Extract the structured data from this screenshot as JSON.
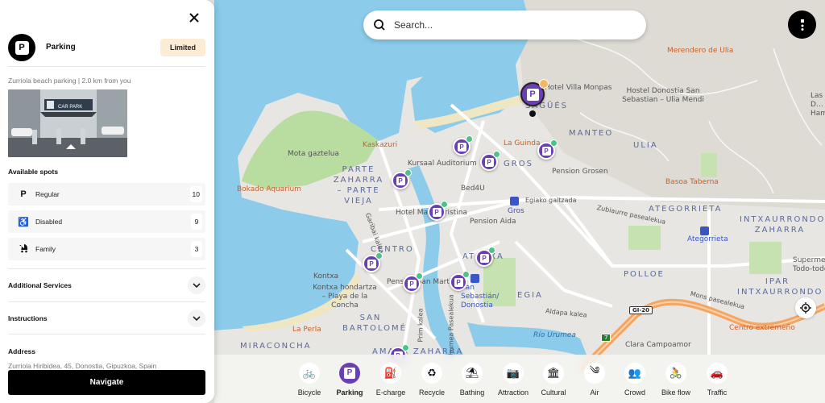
{
  "panel": {
    "title": "Parking",
    "status": "Limited",
    "subtitle": "Zurriola beach parking | 2.0 km from you",
    "photo_sign": "CAR PARK",
    "spots_heading": "Available spots",
    "spots": [
      {
        "icon": "parking-icon",
        "label": "Regular",
        "count": "10"
      },
      {
        "icon": "wheelchair-icon",
        "label": "Disabled",
        "count": "9"
      },
      {
        "icon": "stroller-icon",
        "label": "Family",
        "count": "3"
      }
    ],
    "sections": [
      {
        "label": "Additional Services"
      },
      {
        "label": "Instructions"
      }
    ],
    "address_heading": "Address",
    "address": "Zurriola Hiribidea, 45, Donostia, Gipuzkoa, Spain",
    "navigate_label": "Navigate"
  },
  "search": {
    "placeholder": "Search..."
  },
  "categories": [
    {
      "label": "Bicycle",
      "icon": "bicycle-icon",
      "glyph": "🚲",
      "active": false
    },
    {
      "label": "Parking",
      "icon": "parking-icon",
      "glyph": "P",
      "active": true
    },
    {
      "label": "E-charge",
      "icon": "ev-charger-icon",
      "glyph": "⛽",
      "active": false
    },
    {
      "label": "Recycle",
      "icon": "recycle-icon",
      "glyph": "♻",
      "active": false
    },
    {
      "label": "Bathing",
      "icon": "beach-icon",
      "glyph": "⛱",
      "active": false
    },
    {
      "label": "Attraction",
      "icon": "camera-icon",
      "glyph": "📷",
      "active": false
    },
    {
      "label": "Cultural",
      "icon": "museum-icon",
      "glyph": "🏛",
      "active": false
    },
    {
      "label": "Air",
      "icon": "wind-icon",
      "glyph": "༄",
      "active": false
    },
    {
      "label": "Crowd",
      "icon": "crowd-icon",
      "glyph": "👥",
      "active": false
    },
    {
      "label": "Bike flow",
      "icon": "cyclist-icon",
      "glyph": "🚴",
      "active": false
    },
    {
      "label": "Traffic",
      "icon": "car-icon",
      "glyph": "🚗",
      "active": false
    }
  ],
  "map": {
    "labels": [
      {
        "text": "Merendero de Ulia",
        "kind": "poi-food"
      },
      {
        "text": "Hotel Villa Monpas",
        "kind": "poi"
      },
      {
        "text": "Hostel Donostia San Sebastian – Ulia Mendi",
        "kind": "poi"
      },
      {
        "text": "Las D… Ham…",
        "kind": "poi"
      },
      {
        "text": "SAGÜÉS",
        "kind": "district"
      },
      {
        "text": "MANTEO",
        "kind": "district"
      },
      {
        "text": "ULIA",
        "kind": "district"
      },
      {
        "text": "La Guinda",
        "kind": "poi-food"
      },
      {
        "text": "GROS",
        "kind": "district"
      },
      {
        "text": "Pension Grosen",
        "kind": "poi"
      },
      {
        "text": "Basoa Taberna",
        "kind": "poi-food"
      },
      {
        "text": "Mota gaztelua",
        "kind": "poi"
      },
      {
        "text": "Kaskazuri",
        "kind": "poi-food"
      },
      {
        "text": "Kursaal Auditorium",
        "kind": "poi"
      },
      {
        "text": "PARTE ZAHARRA – PARTE VIEJA",
        "kind": "district"
      },
      {
        "text": "Bokado Aquarium",
        "kind": "poi-food"
      },
      {
        "text": "Bed4U",
        "kind": "poi"
      },
      {
        "text": "Egiako galtzada",
        "kind": "street"
      },
      {
        "text": "Gros",
        "kind": "transit"
      },
      {
        "text": "Zubiaurre pasealekua",
        "kind": "street"
      },
      {
        "text": "ATEGORRIETA",
        "kind": "district"
      },
      {
        "text": "INTXAURRONDO ZAHARRA",
        "kind": "district"
      },
      {
        "text": "Hotel Maria Cristina",
        "kind": "poi"
      },
      {
        "text": "Pension Aida",
        "kind": "poi"
      },
      {
        "text": "Ategorrieta",
        "kind": "transit"
      },
      {
        "text": "Garibai kalea",
        "kind": "street"
      },
      {
        "text": "CENTRO",
        "kind": "district"
      },
      {
        "text": "ATOTXA",
        "kind": "district"
      },
      {
        "text": "Supermercado Todo-todo",
        "kind": "poi"
      },
      {
        "text": "POLLOE",
        "kind": "district"
      },
      {
        "text": "Kontxa",
        "kind": "poi"
      },
      {
        "text": "Kontxa hondartza – Playa de la Concha",
        "kind": "poi"
      },
      {
        "text": "Pension San Martin",
        "kind": "poi"
      },
      {
        "text": "San Sebastián/ Donostia",
        "kind": "transit"
      },
      {
        "text": "IPAR INTXAURRONDO",
        "kind": "district"
      },
      {
        "text": "EGIA",
        "kind": "district"
      },
      {
        "text": "Aldapa kalea",
        "kind": "street"
      },
      {
        "text": "GI-20",
        "kind": "road-shield"
      },
      {
        "text": "Mons pasealekua",
        "kind": "street"
      },
      {
        "text": "La Perla",
        "kind": "poi-food"
      },
      {
        "text": "SAN BARTOLOMÉ",
        "kind": "district"
      },
      {
        "text": "Prim kalea",
        "kind": "street"
      },
      {
        "text": "Urumea Pasealekua",
        "kind": "street"
      },
      {
        "text": "Río Urumea",
        "kind": "water"
      },
      {
        "text": "7",
        "kind": "exit"
      },
      {
        "text": "Centro extremeño",
        "kind": "poi-food"
      },
      {
        "text": "MIRACONCHA",
        "kind": "district"
      },
      {
        "text": "AMARA ZAHARRA",
        "kind": "district"
      },
      {
        "text": "Clara Campoamor",
        "kind": "poi"
      }
    ]
  }
}
